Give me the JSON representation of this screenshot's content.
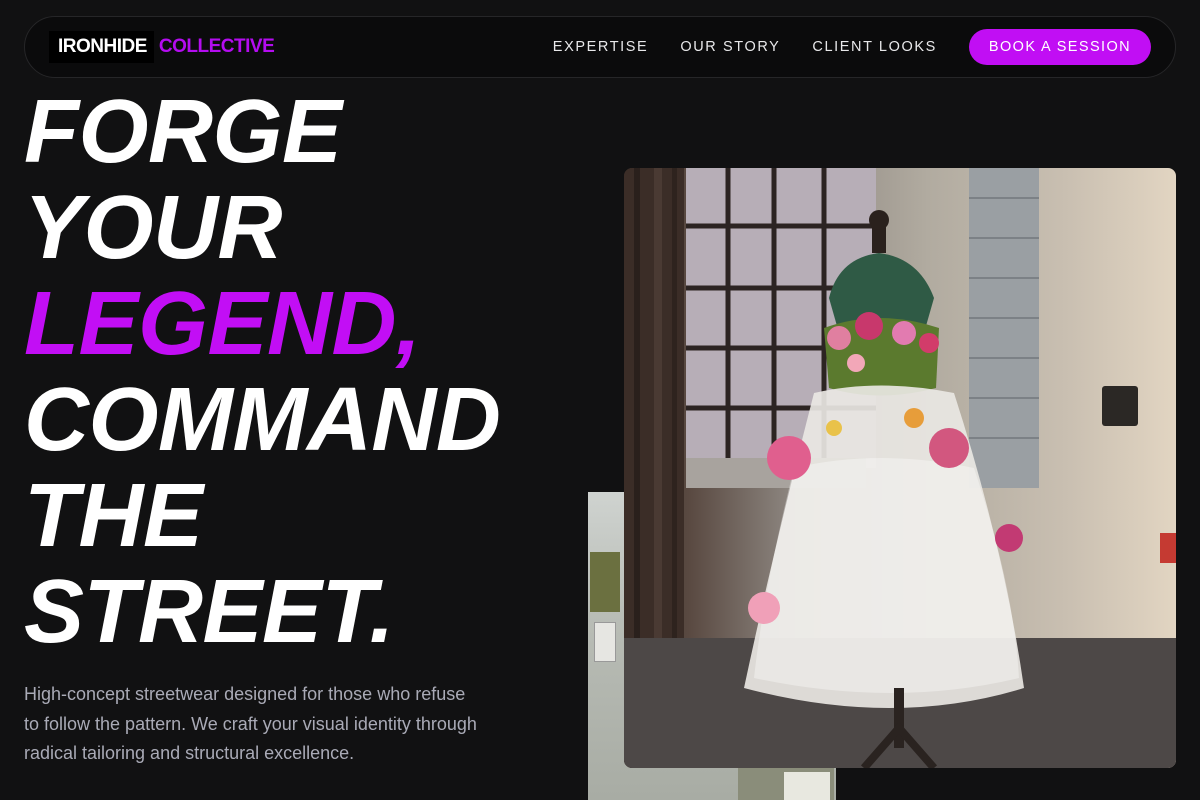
{
  "brand": {
    "name_part1": "IRONHIDE",
    "name_part2": "COLLECTIVE",
    "accent_color": "#c10ef4"
  },
  "nav": {
    "links": [
      "EXPERTISE",
      "OUR STORY",
      "CLIENT LOOKS"
    ],
    "cta_label": "BOOK A SESSION"
  },
  "hero": {
    "lines": [
      "FORGE",
      "YOUR",
      "LEGEND,",
      "COMMAND",
      "THE",
      "STREET."
    ],
    "accent_line_index": 2,
    "description": "High-concept streetwear designed for those who refuse to follow the pattern. We craft your visual identity through radical tailoring and structural excellence."
  },
  "images": {
    "main": "floral-dress-mannequin-photo",
    "back": "studio-wall-photo"
  }
}
